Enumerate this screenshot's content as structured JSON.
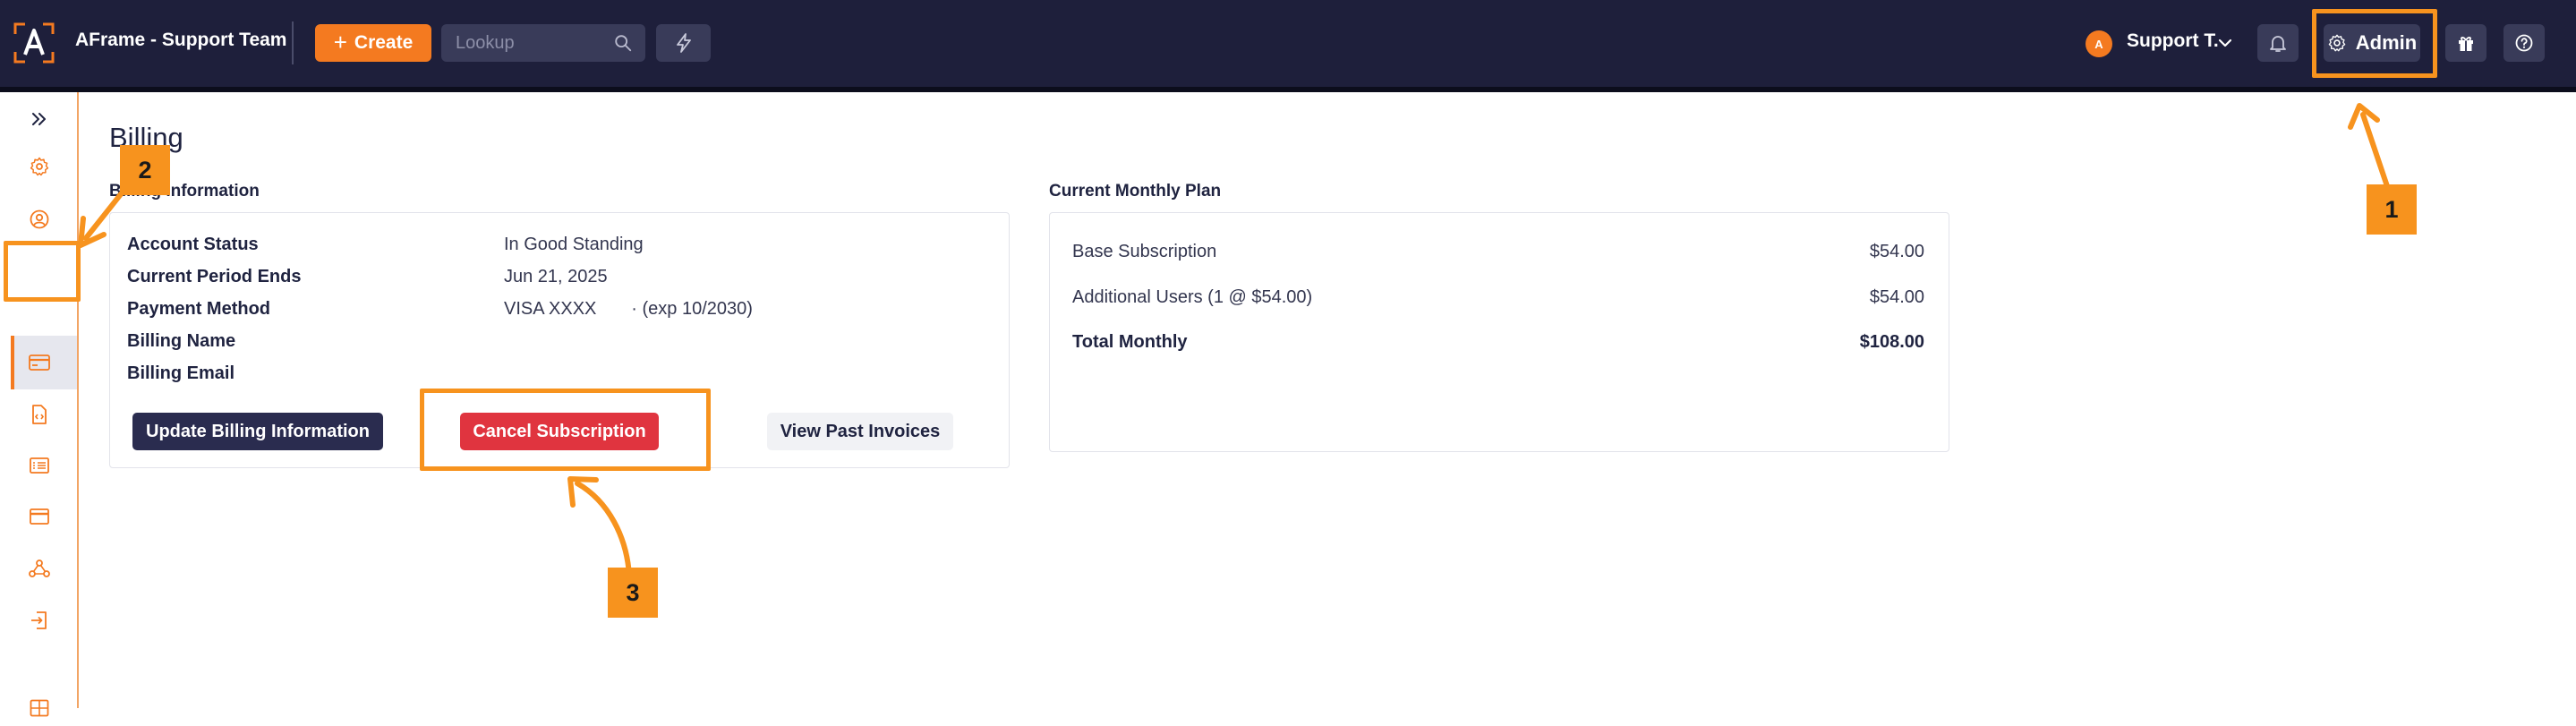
{
  "header": {
    "app_title": "AFrame - Support Team",
    "create_label": "Create",
    "lookup_placeholder": "Lookup",
    "user_initial": "A",
    "user_name": "Support T.",
    "admin_label": "Admin"
  },
  "sidebar": {
    "items": [
      {
        "icon": "expand-chevrons-icon"
      },
      {
        "icon": "gear-icon"
      },
      {
        "icon": "user-circle-icon"
      },
      {
        "icon": "credit-card-icon",
        "active": true
      },
      {
        "icon": "code-file-icon"
      },
      {
        "icon": "list-icon"
      },
      {
        "icon": "browser-window-icon"
      },
      {
        "icon": "webhook-icon"
      },
      {
        "icon": "login-icon"
      },
      {
        "icon": "grid-icon"
      }
    ]
  },
  "page": {
    "title": "Billing",
    "billing_info_label": "Billing Information",
    "plan_label": "Current Monthly Plan"
  },
  "billing": {
    "rows": [
      {
        "key": "Account Status",
        "value": "In Good Standing"
      },
      {
        "key": "Current Period Ends",
        "value": "Jun 21, 2025"
      },
      {
        "key": "Payment Method",
        "value": "VISA XXXX       · (exp 10/2030)"
      },
      {
        "key": "Billing Name",
        "value": ""
      },
      {
        "key": "Billing Email",
        "value": ""
      }
    ],
    "update_label": "Update Billing Information",
    "cancel_label": "Cancel Subscription",
    "invoices_label": "View Past Invoices"
  },
  "plan": {
    "rows": [
      {
        "label": "Base Subscription",
        "value": "$54.00"
      },
      {
        "label": "Additional Users (1 @ $54.00)",
        "value": "$54.00"
      },
      {
        "label": "Total Monthly",
        "value": "$108.00"
      }
    ]
  },
  "annotations": {
    "marker_1": "1",
    "marker_2": "2",
    "marker_3": "3"
  },
  "colors": {
    "header_bg": "#1e1f3b",
    "accent_orange": "#f47a20",
    "annotation_orange": "#f7931e",
    "cancel_red": "#e0343f",
    "primary_navy": "#2a2c4f"
  }
}
